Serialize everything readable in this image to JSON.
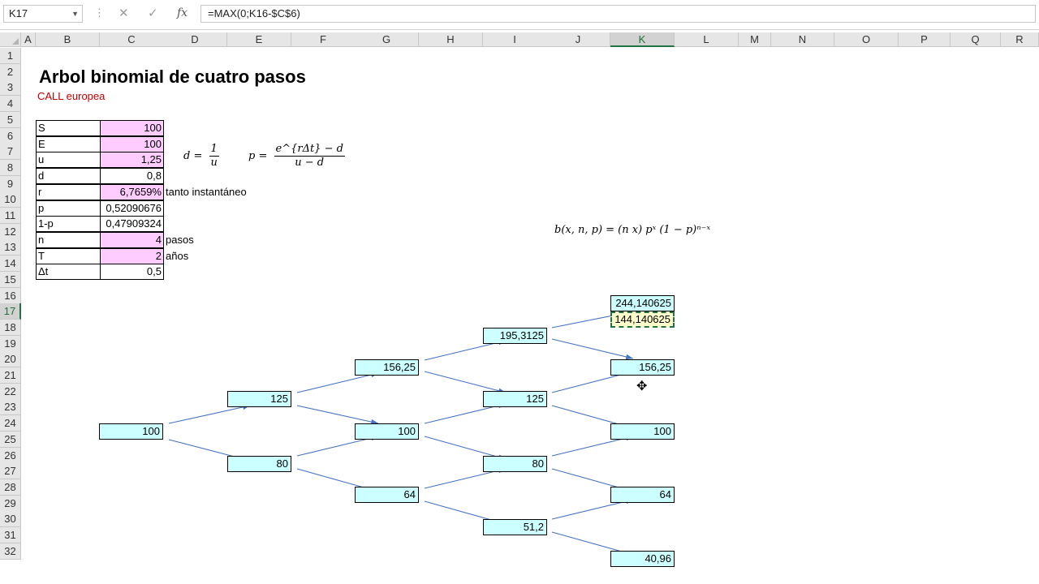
{
  "formula_bar": {
    "cell_ref": "K17",
    "cancel_icon": "✕",
    "enter_icon": "✓",
    "fx_label": "fx",
    "formula": "=MAX(0;K16-$C$6)"
  },
  "columns": [
    "A",
    "B",
    "C",
    "D",
    "E",
    "F",
    "G",
    "H",
    "I",
    "J",
    "K",
    "L",
    "M",
    "N",
    "O",
    "P",
    "Q",
    "R"
  ],
  "selected_column": "K",
  "rows": [
    "1",
    "2",
    "3",
    "4",
    "5",
    "6",
    "7",
    "8",
    "9",
    "10",
    "11",
    "12",
    "13",
    "14",
    "15",
    "16",
    "17",
    "18",
    "19",
    "20",
    "21",
    "22",
    "23",
    "24",
    "25",
    "26",
    "27",
    "28",
    "29",
    "30",
    "31",
    "32"
  ],
  "selected_row": "17",
  "sheet": {
    "title": "Arbol binomial de cuatro pasos",
    "subtitle": "CALL europea",
    "params": [
      {
        "label": "S",
        "value": "100",
        "pink": true
      },
      {
        "label": "E",
        "value": "100",
        "pink": true
      },
      {
        "label": "u",
        "value": "1,25",
        "pink": true
      },
      {
        "label": "d",
        "value": "0,8",
        "pink": false
      },
      {
        "label": "r",
        "value": "6,7659%",
        "pink": true
      },
      {
        "label": "p",
        "value": "0,52090676",
        "pink": false
      },
      {
        "label": "1-p",
        "value": "0,47909324",
        "pink": false
      },
      {
        "label": "n",
        "value": "4",
        "pink": true
      },
      {
        "label": "T",
        "value": "2",
        "pink": true
      },
      {
        "label": "Δt",
        "value": "0,5",
        "pink": false
      }
    ],
    "notes": {
      "r": "tanto instantáneo",
      "n": "pasos",
      "T": "años"
    },
    "formulas": {
      "d_lhs": "d =",
      "d_num": "1",
      "d_den": "u",
      "p_lhs": "p =",
      "p_num": "e^{rΔt} − d",
      "p_den": "u − d",
      "binom": "b(x, n, p) = (n x) pˣ (1 − p)ⁿ⁻ˣ"
    },
    "tree": {
      "n0": "100",
      "n1u": "125",
      "n1d": "80",
      "n2uu": "156,25",
      "n2ud": "100",
      "n2dd": "64",
      "n3a": "195,3125",
      "n3b": "125",
      "n3c": "80",
      "n3d": "51,2",
      "n4a": "244,140625",
      "n4a_payoff": "144,140625",
      "n4b": "156,25",
      "n4c": "100",
      "n4d": "64",
      "n4e": "40,96"
    }
  },
  "colors": {
    "accent": "#217346",
    "node_fill": "#ccffff",
    "input_fill": "#ffccff",
    "arrow": "#4472c4",
    "title_red": "#c00000"
  }
}
